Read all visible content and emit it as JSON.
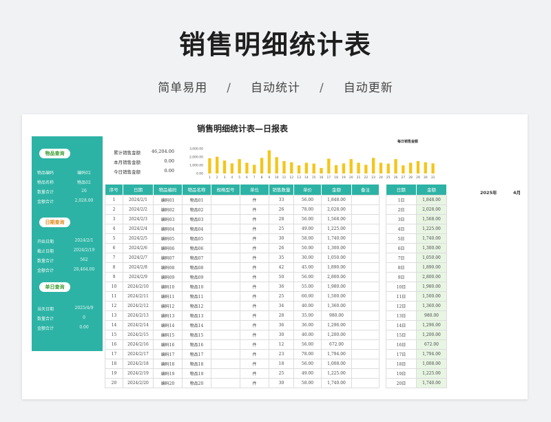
{
  "hero": {
    "title": "销售明细统计表",
    "tags": [
      "简单易用",
      "自动统计",
      "自动更新"
    ],
    "separator": "/"
  },
  "sheet": {
    "title": "销售明细统计表—日报表",
    "panel": {
      "item_query": {
        "label": "物品查询",
        "rows": [
          {
            "k": "物品编码",
            "v": "编码02"
          },
          {
            "k": "物品名称",
            "v": "物品02"
          },
          {
            "k": "数量合计",
            "v": "26"
          },
          {
            "k": "金额合计",
            "v": "2,028.00"
          }
        ]
      },
      "date_query": {
        "label": "日期查询",
        "rows": [
          {
            "k": "开始日期",
            "v": "2024/2/1"
          },
          {
            "k": "截止日期",
            "v": "2024/2/19"
          },
          {
            "k": "数量合计",
            "v": "562"
          },
          {
            "k": "金额合计",
            "v": "28,464.00"
          }
        ]
      },
      "day_query": {
        "label": "单日查询",
        "rows": [
          {
            "k": "当天日期",
            "v": "2025/4/9"
          },
          {
            "k": "数量合计",
            "v": "0"
          },
          {
            "k": "金额合计",
            "v": "0.00"
          }
        ]
      }
    },
    "summary": [
      {
        "k": "累计销售金额",
        "v": "46,204.00"
      },
      {
        "k": "本月销售金额",
        "v": "0.00"
      },
      {
        "k": "今日销售金额",
        "v": "0.00"
      }
    ],
    "year": "2025年",
    "month": "4月",
    "colors": {
      "teal": "#2db3a5",
      "bar": "#f5c518",
      "green_pill": "#3a9a2f",
      "orange_pill": "#e08a1c"
    }
  },
  "chart_data": {
    "type": "bar",
    "title": "每日销售金额",
    "categories": [
      "1",
      "2",
      "3",
      "4",
      "5",
      "6",
      "7",
      "8",
      "9",
      "10",
      "11",
      "12",
      "13",
      "14",
      "15",
      "16",
      "17",
      "18",
      "19",
      "20",
      "21",
      "22",
      "23",
      "24",
      "25",
      "26",
      "27",
      "28",
      "29",
      "30",
      "31"
    ],
    "values": [
      1848,
      2028,
      1568,
      1225,
      1740,
      1300,
      1050,
      1890,
      2800,
      1980,
      1500,
      1360,
      980,
      1296,
      1200,
      672,
      1794,
      1008,
      1225,
      1740,
      1300,
      1050,
      1890,
      1296,
      1200,
      1740,
      980,
      1296,
      1500,
      1360,
      1225
    ],
    "yticks": [
      "3,000.00",
      "2,000.00",
      "1,000.00",
      "0.00"
    ],
    "ylim": [
      0,
      3000
    ]
  },
  "table": {
    "headers": [
      "序号",
      "日期",
      "物品编码",
      "物品名称",
      "规格型号",
      "单位",
      "销售数量",
      "单价",
      "金额",
      "备注"
    ],
    "rows": [
      [
        "1",
        "2024/2/1",
        "编码01",
        "物品01",
        "",
        "件",
        "33",
        "56.00",
        "1,848.00",
        ""
      ],
      [
        "2",
        "2024/2/2",
        "编码02",
        "物品02",
        "",
        "件",
        "26",
        "78.00",
        "2,028.00",
        ""
      ],
      [
        "3",
        "2024/2/3",
        "编码03",
        "物品03",
        "",
        "件",
        "28",
        "56.00",
        "1,568.00",
        ""
      ],
      [
        "4",
        "2024/2/4",
        "编码04",
        "物品04",
        "",
        "件",
        "25",
        "49.00",
        "1,225.00",
        ""
      ],
      [
        "5",
        "2024/2/5",
        "编码05",
        "物品05",
        "",
        "件",
        "30",
        "58.00",
        "1,740.00",
        ""
      ],
      [
        "6",
        "2024/2/6",
        "编码06",
        "物品06",
        "",
        "件",
        "26",
        "50.00",
        "1,300.00",
        ""
      ],
      [
        "7",
        "2024/2/7",
        "编码07",
        "物品07",
        "",
        "件",
        "35",
        "30.00",
        "1,050.00",
        ""
      ],
      [
        "8",
        "2024/2/8",
        "编码08",
        "物品08",
        "",
        "件",
        "42",
        "45.00",
        "1,890.00",
        ""
      ],
      [
        "9",
        "2024/2/9",
        "编码09",
        "物品09",
        "",
        "件",
        "50",
        "56.00",
        "2,800.00",
        ""
      ],
      [
        "10",
        "2024/2/10",
        "编码10",
        "物品10",
        "",
        "件",
        "36",
        "55.00",
        "1,980.00",
        ""
      ],
      [
        "11",
        "2024/2/11",
        "编码11",
        "物品11",
        "",
        "件",
        "25",
        "60.00",
        "1,500.00",
        ""
      ],
      [
        "12",
        "2024/2/12",
        "编码12",
        "物品12",
        "",
        "件",
        "34",
        "40.00",
        "1,360.00",
        ""
      ],
      [
        "13",
        "2024/2/13",
        "编码13",
        "物品13",
        "",
        "件",
        "28",
        "35.00",
        "980.00",
        ""
      ],
      [
        "14",
        "2024/2/14",
        "编码14",
        "物品14",
        "",
        "件",
        "36",
        "36.00",
        "1,296.00",
        ""
      ],
      [
        "15",
        "2024/2/15",
        "编码15",
        "物品15",
        "",
        "件",
        "30",
        "40.00",
        "1,200.00",
        ""
      ],
      [
        "16",
        "2024/2/16",
        "编码16",
        "物品16",
        "",
        "件",
        "12",
        "56.00",
        "672.00",
        ""
      ],
      [
        "17",
        "2024/2/17",
        "编码17",
        "物品17",
        "",
        "件",
        "23",
        "78.00",
        "1,794.00",
        ""
      ],
      [
        "18",
        "2024/2/18",
        "编码18",
        "物品18",
        "",
        "件",
        "18",
        "56.00",
        "1,008.00",
        ""
      ],
      [
        "19",
        "2024/2/19",
        "编码19",
        "物品19",
        "",
        "件",
        "25",
        "49.00",
        "1,225.00",
        ""
      ],
      [
        "20",
        "2024/2/20",
        "编码20",
        "物品20",
        "",
        "件",
        "30",
        "58.00",
        "1,740.00",
        ""
      ]
    ]
  },
  "day_table": {
    "headers": [
      "日期",
      "金额"
    ],
    "rows": [
      [
        "1日",
        "1,848.00"
      ],
      [
        "2日",
        "2,028.00"
      ],
      [
        "3日",
        "1,568.00"
      ],
      [
        "4日",
        "1,225.00"
      ],
      [
        "5日",
        "1,740.00"
      ],
      [
        "6日",
        "1,300.00"
      ],
      [
        "7日",
        "1,050.00"
      ],
      [
        "8日",
        "1,890.00"
      ],
      [
        "9日",
        "2,800.00"
      ],
      [
        "10日",
        "1,980.00"
      ],
      [
        "11日",
        "1,500.00"
      ],
      [
        "12日",
        "1,360.00"
      ],
      [
        "13日",
        "980.00"
      ],
      [
        "14日",
        "1,296.00"
      ],
      [
        "15日",
        "1,200.00"
      ],
      [
        "16日",
        "672.00"
      ],
      [
        "17日",
        "1,794.00"
      ],
      [
        "18日",
        "1,008.00"
      ],
      [
        "19日",
        "1,225.00"
      ],
      [
        "20日",
        "1,740.00"
      ]
    ]
  }
}
